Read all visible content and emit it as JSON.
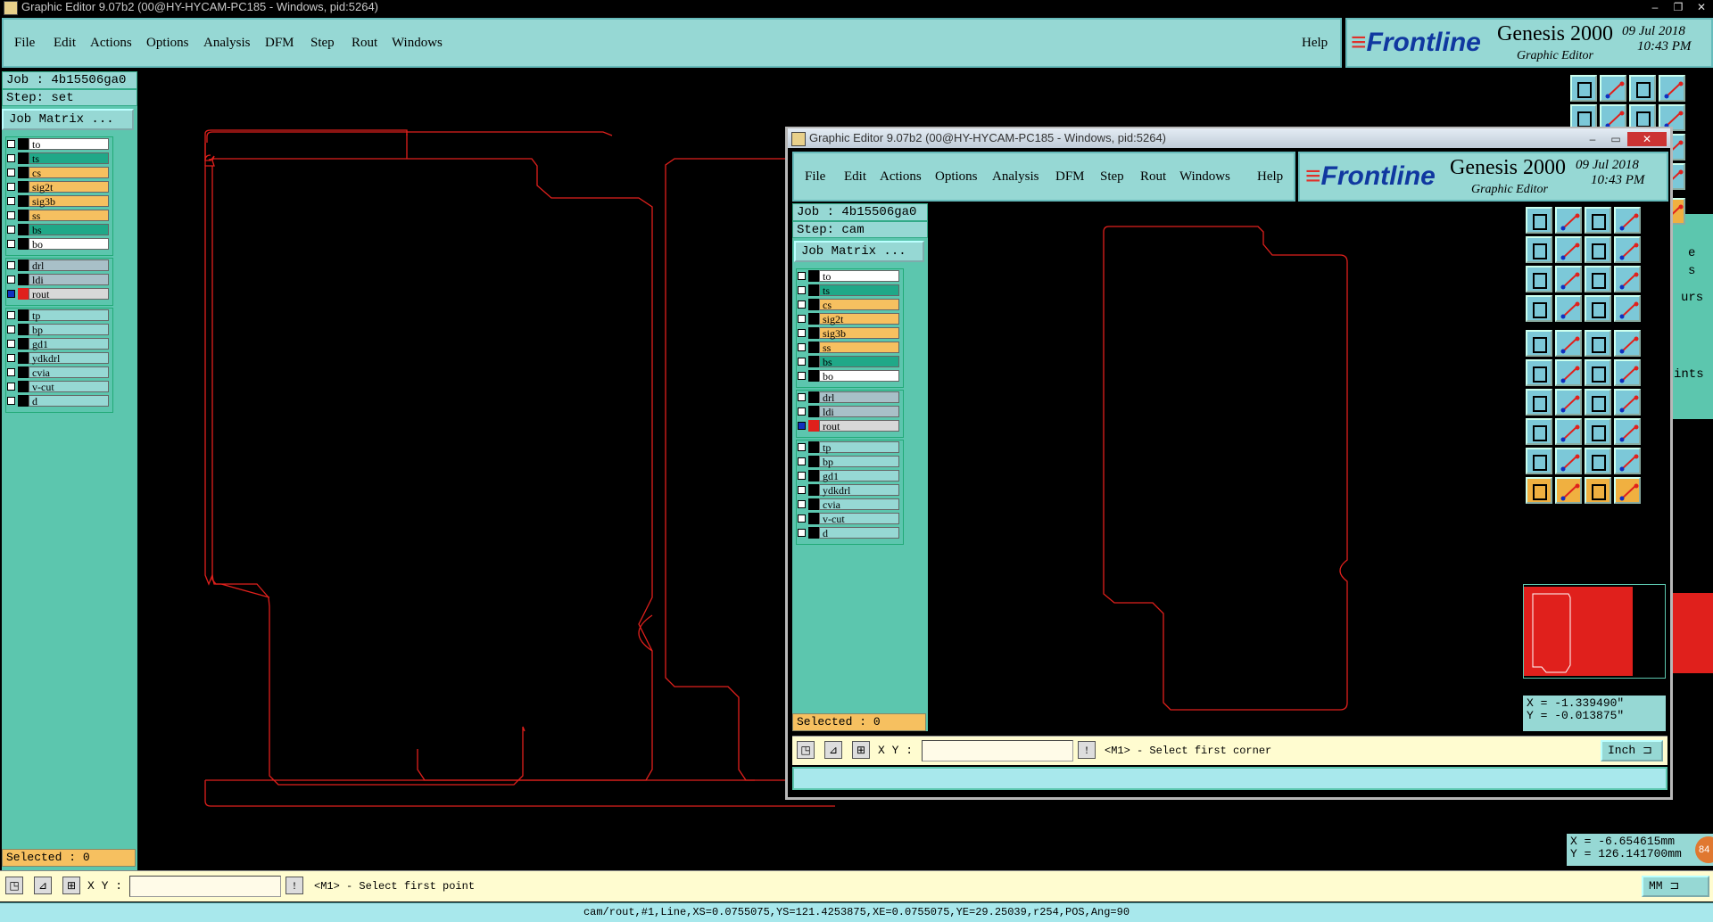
{
  "main_window": {
    "title": "Graphic Editor 9.07b2 (00@HY-HYCAM-PC185 - Windows, pid:5264)",
    "menus": [
      "File",
      "Edit",
      "Actions",
      "Options",
      "Analysis",
      "DFM",
      "Step",
      "Rout",
      "Windows"
    ],
    "help": "Help",
    "brand": {
      "logo": "Frontline",
      "product": "Genesis 2000",
      "subtitle": "Graphic Editor",
      "date": "09 Jul 2018",
      "time": "10:43 PM"
    },
    "job": "Job : 4b15506ga0",
    "step": "Step: set",
    "job_matrix": "Job Matrix ...",
    "selected": "Selected : 0",
    "xy_label": "X Y :",
    "prompt": "<M1> - Select first point",
    "unit": "MM",
    "coords": {
      "x": "X = -6.654615mm",
      "y": "Y = 126.141700mm"
    },
    "status": "cam/rout,#1,Line,XS=0.0755075,YS=121.4253875,XE=0.0755075,YE=29.25039,r254,POS,Ang=90",
    "badge": "84",
    "side_fragments": [
      "e",
      "s",
      "urs",
      "ints"
    ]
  },
  "sub_window": {
    "title": "Graphic Editor 9.07b2 (00@HY-HYCAM-PC185 - Windows, pid:5264)",
    "menus": [
      "File",
      "Edit",
      "Actions",
      "Options",
      "Analysis",
      "DFM",
      "Step",
      "Rout",
      "Windows"
    ],
    "help": "Help",
    "brand": {
      "logo": "Frontline",
      "product": "Genesis 2000",
      "subtitle": "Graphic Editor",
      "date": "09 Jul 2018",
      "time": "10:43 PM"
    },
    "job": "Job : 4b15506ga0",
    "step": "Step: cam",
    "job_matrix": "Job Matrix ...",
    "selected": "Selected : 0",
    "xy_label": "X Y :",
    "prompt": "<M1> - Select first corner",
    "unit": "Inch",
    "coords": {
      "x": "X = -1.339490\"",
      "y": "Y = -0.013875\""
    }
  },
  "layer_groups": [
    [
      {
        "name": "to",
        "color": "#ffffff"
      },
      {
        "name": "ts",
        "color": "#20a888"
      },
      {
        "name": "cs",
        "color": "#f6c060"
      },
      {
        "name": "sig2t",
        "color": "#f6c060"
      },
      {
        "name": "sig3b",
        "color": "#f6c060"
      },
      {
        "name": "ss",
        "color": "#f6c060"
      },
      {
        "name": "bs",
        "color": "#20a888"
      },
      {
        "name": "bo",
        "color": "#ffffff"
      }
    ],
    [
      {
        "name": "drl",
        "color": "#a8c0c8"
      },
      {
        "name": "ldi",
        "color": "#a8c0c8"
      },
      {
        "name": "rout",
        "color": "#d8d8d8",
        "active": true
      }
    ],
    [
      {
        "name": "tp",
        "color": "#96d8d4"
      },
      {
        "name": "bp",
        "color": "#96d8d4"
      },
      {
        "name": "gd1",
        "color": "#96d8d4"
      },
      {
        "name": "ydkdrl",
        "color": "#96d8d4"
      },
      {
        "name": "cvia",
        "color": "#96d8d4"
      },
      {
        "name": "v-cut",
        "color": "#96d8d4"
      },
      {
        "name": "d",
        "color": "#96d8d4"
      }
    ]
  ],
  "colors": {
    "outline": "#e0201c",
    "panel": "#5cc6ae",
    "menubar": "#96d8d4",
    "active_layer": "#e0201c"
  }
}
